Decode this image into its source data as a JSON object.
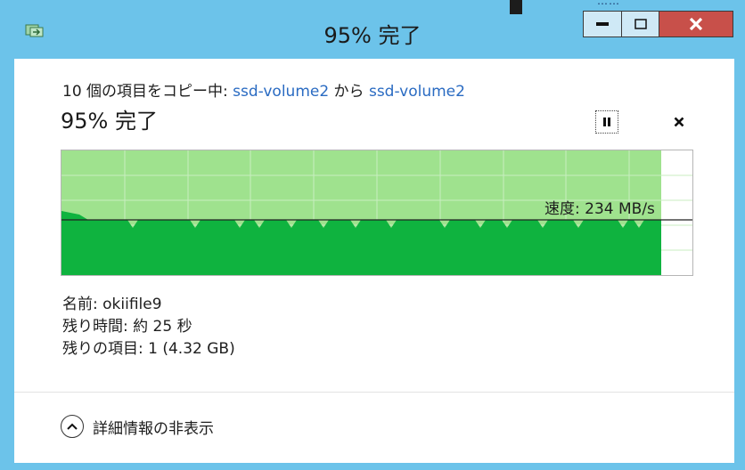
{
  "window": {
    "title": "95% 完了",
    "minimize_glyph": "—",
    "maximize_glyph": "□",
    "close_glyph": "X"
  },
  "desktop": {
    "label": "……"
  },
  "copy": {
    "prefix": "10 個の項目をコピー中: ",
    "source": "ssd-volume2",
    "middle": " から ",
    "destination": "ssd-volume2"
  },
  "progress": {
    "text": "95% 完了",
    "percent": 95,
    "pause_icon": "pause-icon",
    "cancel_glyph": "✕"
  },
  "speed": {
    "text": "速度: 234 MB/s"
  },
  "details": {
    "name": "名前: okiifile9",
    "time_remaining": "残り時間: 約 25 秒",
    "items_remaining": "残りの項目: 1 (4.32 GB)"
  },
  "footer": {
    "label": "詳細情報の非表示",
    "icon": "chevron-up-icon"
  },
  "colors": {
    "frame": "#6cc3ea",
    "graph_light": "#9fe28e",
    "graph_dark": "#0fb33f",
    "link": "#2a6bc2",
    "close_button": "#c8504a"
  }
}
